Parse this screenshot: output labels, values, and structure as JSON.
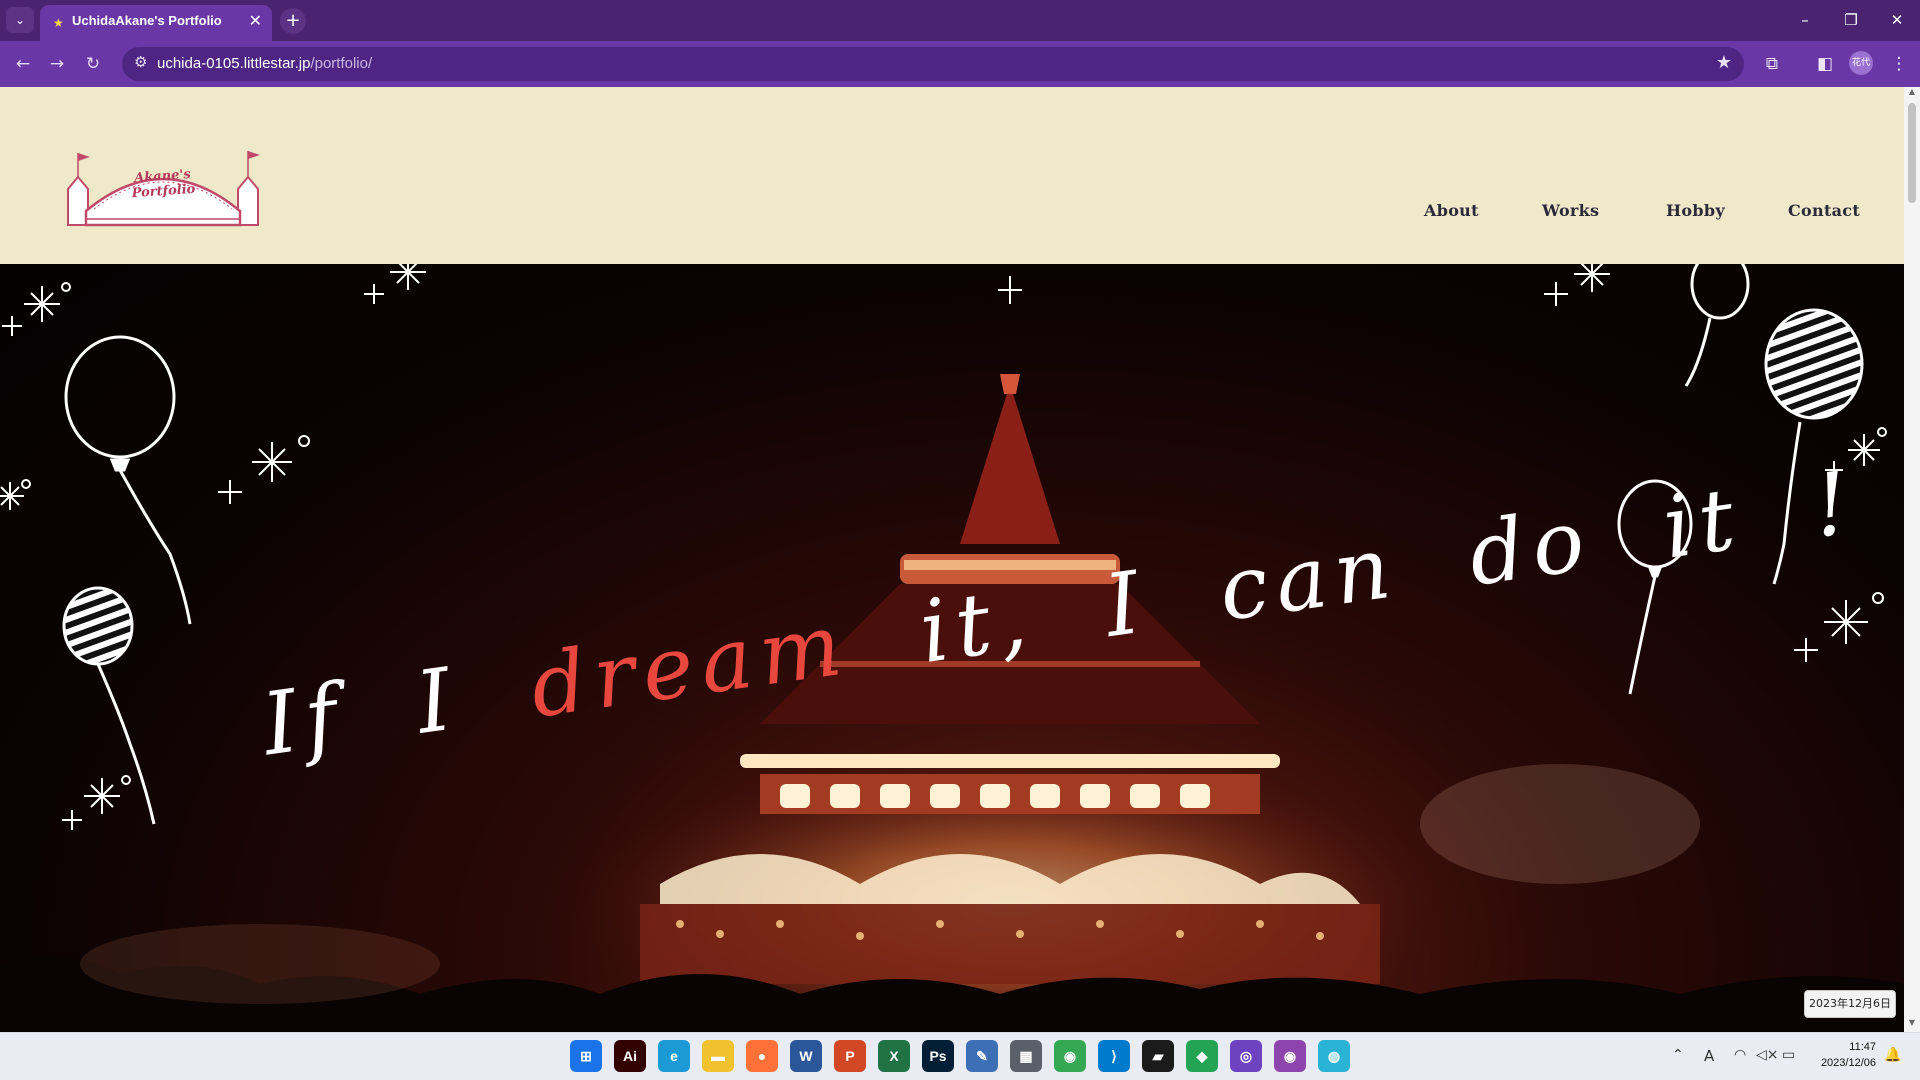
{
  "browser": {
    "tab_title": "UchidaAkane's Portfolio",
    "tab_close": "✕",
    "new_tab": "+",
    "url_host": "uchida-0105.littlestar.jp",
    "url_path": "/portfolio/",
    "profile_label": "花代",
    "window_controls": [
      "–",
      "❐",
      "✕"
    ]
  },
  "site": {
    "logo_text_line1": "Akane's",
    "logo_text_line2": "Portfolio",
    "nav": [
      "About",
      "Works",
      "Hobby",
      "Contact"
    ],
    "hero": {
      "words": [
        "If",
        "I",
        "dream",
        "it,",
        "I",
        "can",
        "do",
        "it",
        "!"
      ],
      "accent_word": "dream",
      "accent_color": "#e8473d",
      "header_bg": "#efe8c9"
    }
  },
  "tooltip": {
    "date": "2023年12月6日"
  },
  "taskbar": {
    "apps": [
      {
        "name": "windows-start",
        "label": "⊞",
        "color": "#1a73e8"
      },
      {
        "name": "illustrator",
        "label": "Ai",
        "color": "#330000"
      },
      {
        "name": "edge",
        "label": "e",
        "color": "#1c9ad6"
      },
      {
        "name": "file-explorer",
        "label": "▬",
        "color": "#f2c12e"
      },
      {
        "name": "firefox",
        "label": "●",
        "color": "#ff7139"
      },
      {
        "name": "word",
        "label": "W",
        "color": "#2b579a"
      },
      {
        "name": "powerpoint",
        "label": "P",
        "color": "#d24726"
      },
      {
        "name": "excel",
        "label": "X",
        "color": "#217346"
      },
      {
        "name": "photoshop",
        "label": "Ps",
        "color": "#001e36"
      },
      {
        "name": "paint",
        "label": "✎",
        "color": "#3d6fb6"
      },
      {
        "name": "calculator",
        "label": "▦",
        "color": "#5a5f6a"
      },
      {
        "name": "chrome",
        "label": "◉",
        "color": "#34a853"
      },
      {
        "name": "vscode",
        "label": "⟩",
        "color": "#007acc"
      },
      {
        "name": "sticky-notes",
        "label": "▰",
        "color": "#1b1b1b"
      },
      {
        "name": "app-green",
        "label": "◆",
        "color": "#23a455"
      },
      {
        "name": "github-desktop",
        "label": "◎",
        "color": "#6f42c1"
      },
      {
        "name": "chrome-profile",
        "label": "◉",
        "color": "#8e44ad"
      },
      {
        "name": "photos",
        "label": "◍",
        "color": "#2bb3d6"
      }
    ],
    "clock_time": "11:47",
    "clock_date": "2023/12/06",
    "tray_ime": "A"
  }
}
